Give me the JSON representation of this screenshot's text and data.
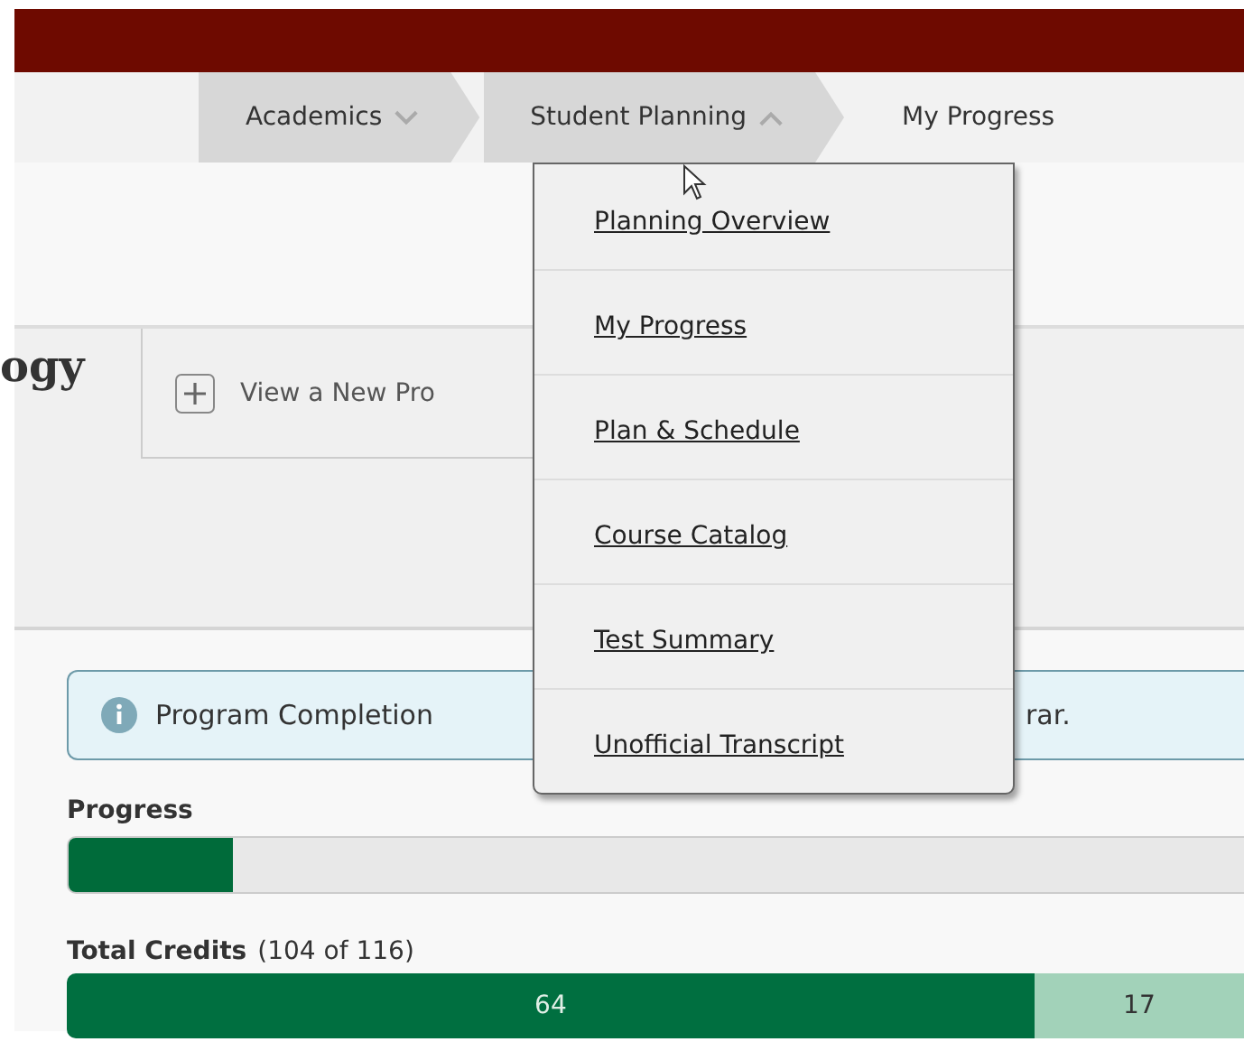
{
  "nav": {
    "items": [
      {
        "label": "Academics",
        "expanded": false,
        "selected": false
      },
      {
        "label": "Student Planning",
        "expanded": true,
        "selected": false
      },
      {
        "label": "My Progress",
        "selected": true
      }
    ]
  },
  "menu": {
    "items": [
      "Planning Overview",
      "My Progress",
      "Plan & Schedule",
      "Course Catalog",
      "Test Summary",
      "Unofficial Transcript"
    ]
  },
  "program": {
    "title": "ogy",
    "new_tab": "View a New Pro"
  },
  "notice": {
    "text_start": "Program Completion",
    "text_end": "rar."
  },
  "progress": {
    "label": "Progress",
    "level": 0.14
  },
  "credits": {
    "label": "Total Credits",
    "count": "(104 of 116)",
    "segments": [
      {
        "label": "64",
        "level": 0.822,
        "kind": "completed"
      },
      {
        "label": "17",
        "level": 0.178,
        "kind": "in_progress"
      }
    ]
  }
}
